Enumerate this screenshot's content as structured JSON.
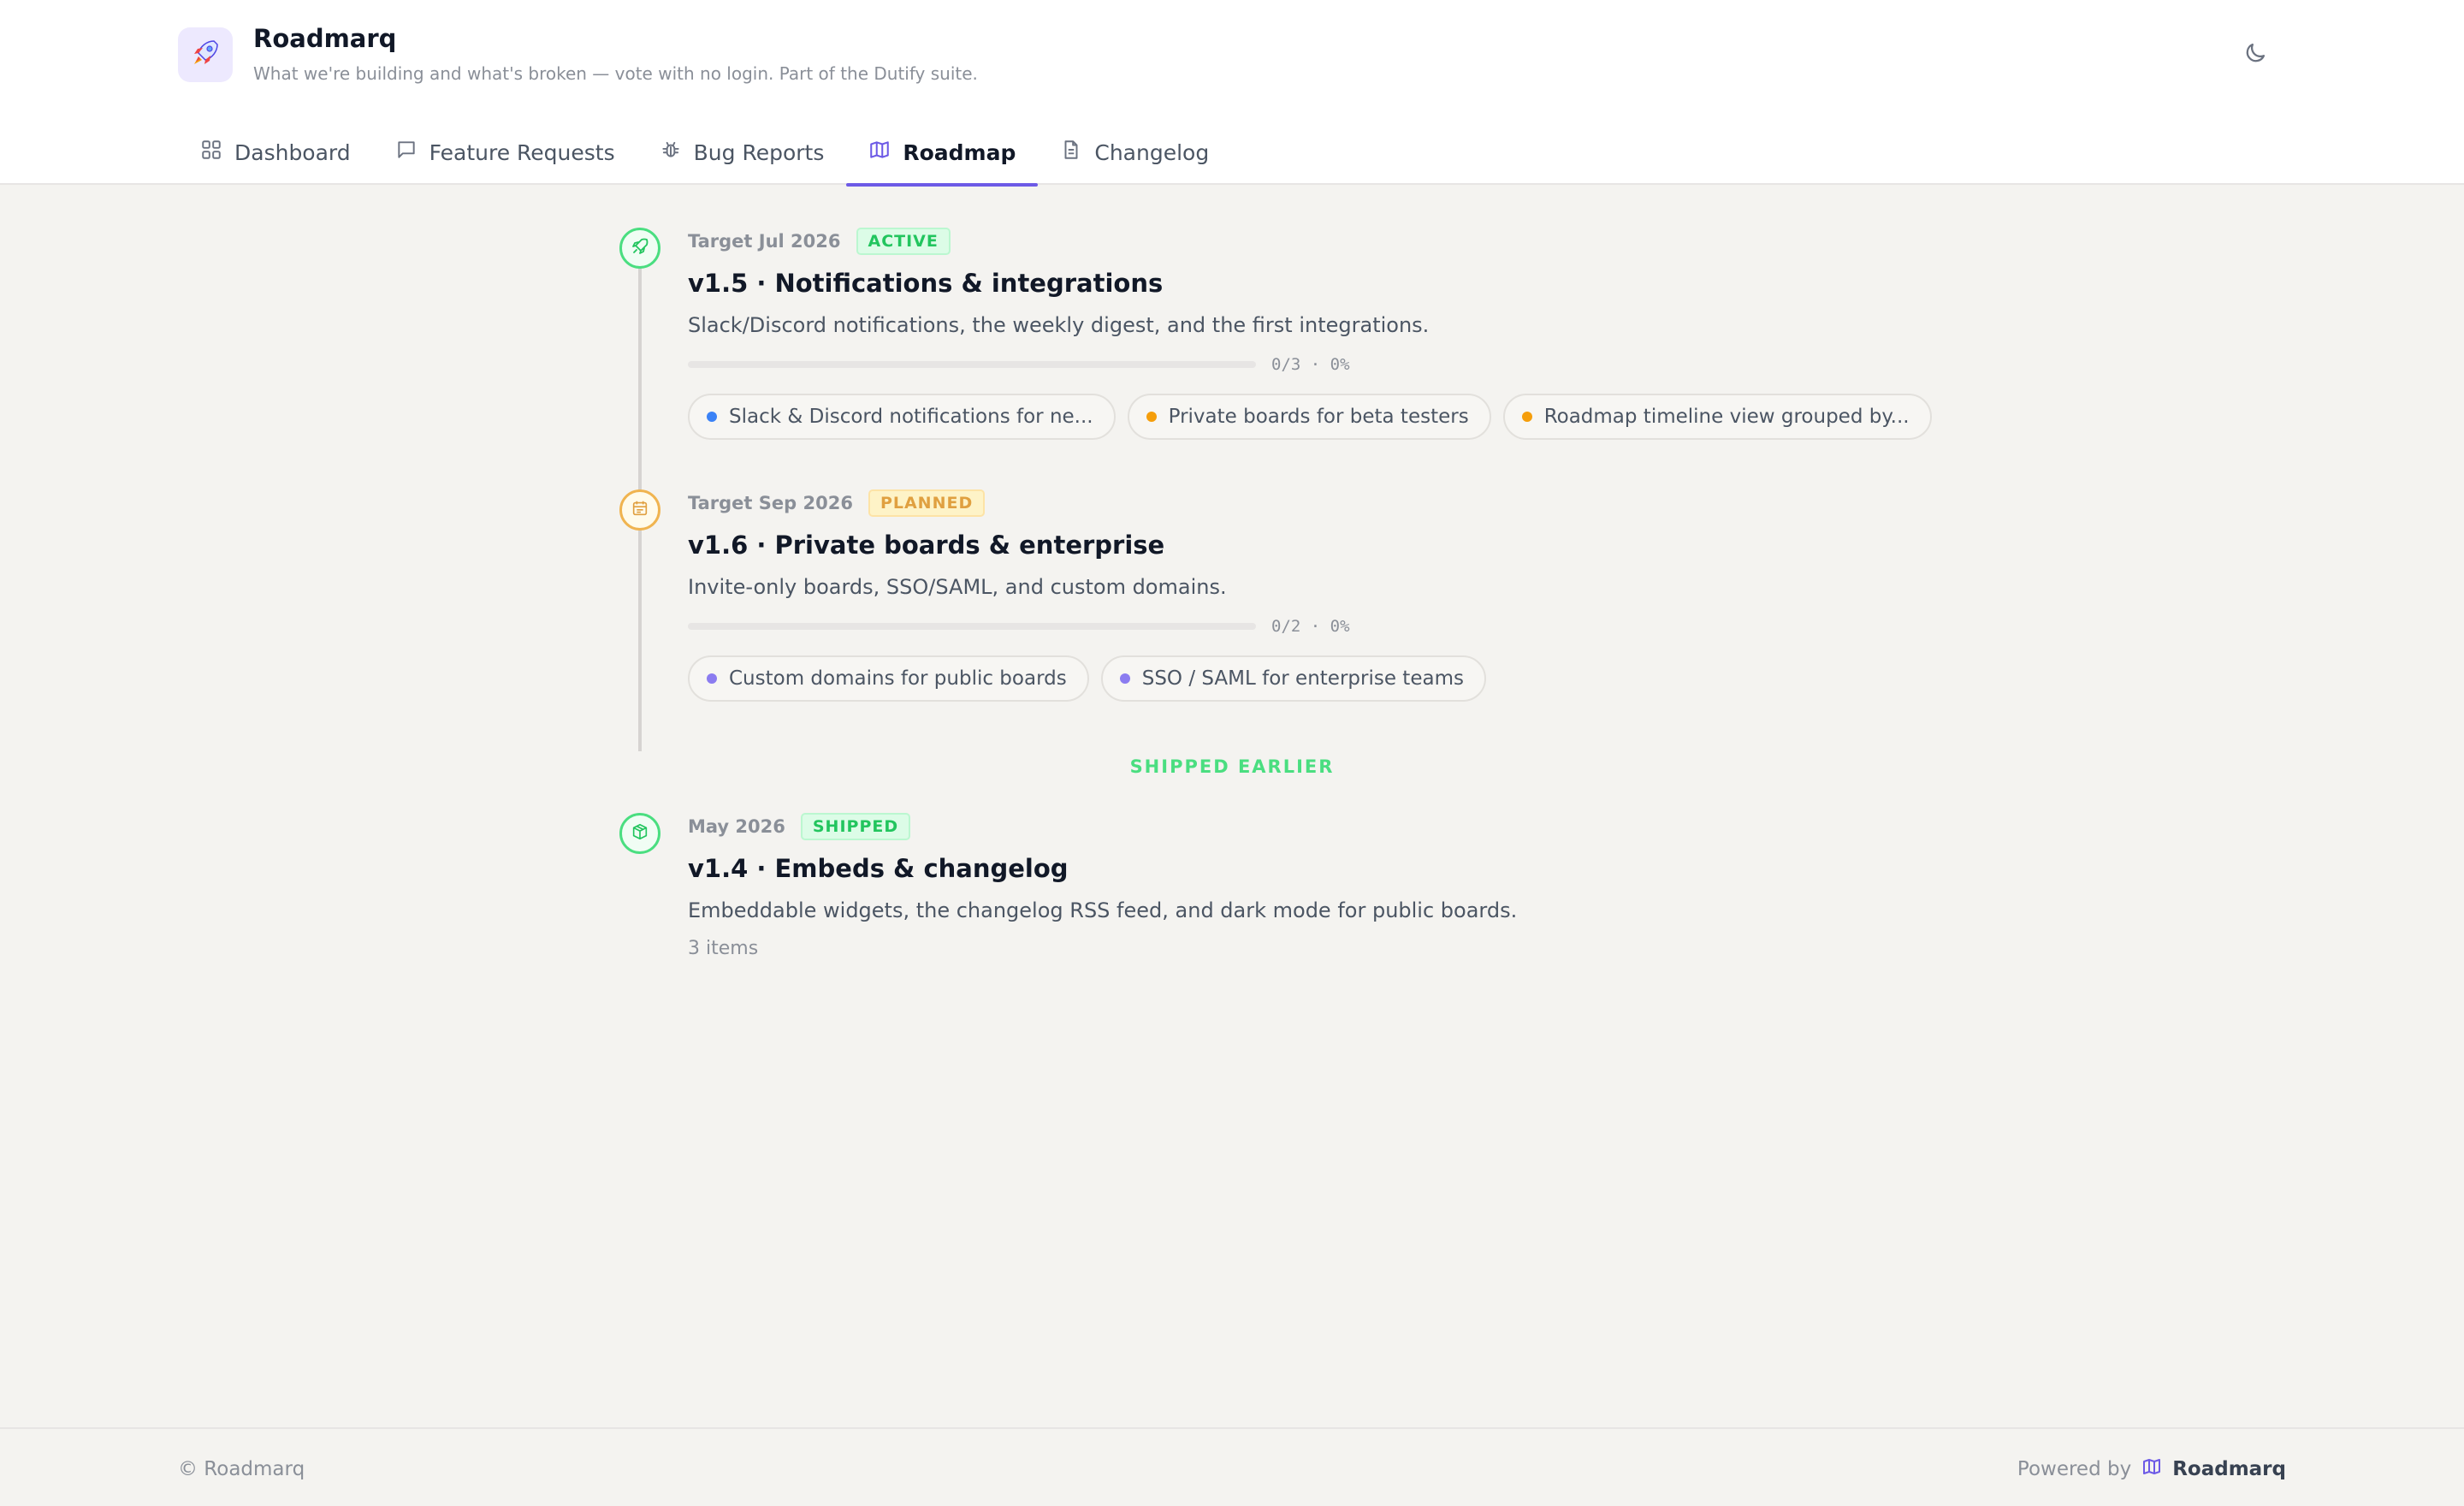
{
  "app": {
    "name": "Roadmarq",
    "tagline": "What we're building and what's broken — vote with no login. Part of the Dutify suite.",
    "logo_icon": "rocket-icon",
    "accent_color": "#6d5ae6"
  },
  "tabs": [
    {
      "label": "Dashboard",
      "icon": "grid-icon",
      "active": false
    },
    {
      "label": "Feature Requests",
      "icon": "message-icon",
      "active": false
    },
    {
      "label": "Bug Reports",
      "icon": "bug-icon",
      "active": false
    },
    {
      "label": "Roadmap",
      "icon": "map-icon",
      "active": true
    },
    {
      "label": "Changelog",
      "icon": "document-icon",
      "active": false
    }
  ],
  "theme_toggle_icon": "moon-icon",
  "releases": [
    {
      "target": "Target Jul 2026",
      "status": "ACTIVE",
      "status_color": "#22c55e",
      "icon": "rocket-icon",
      "title": "v1.5 · Notifications & integrations",
      "description": "Slack/Discord notifications, the weekly digest, and the first integrations.",
      "progress_text": "0/3 · 0%",
      "progress_fraction": 0,
      "items": [
        {
          "label": "Slack & Discord notifications for ne...",
          "color": "#3b82f6"
        },
        {
          "label": "Private boards for beta testers",
          "color": "#f59e0b"
        },
        {
          "label": "Roadmap timeline view grouped by...",
          "color": "#f59e0b"
        }
      ]
    },
    {
      "target": "Target Sep 2026",
      "status": "PLANNED",
      "status_color": "#e0a040",
      "icon": "calendar-icon",
      "title": "v1.6 · Private boards & enterprise",
      "description": "Invite-only boards, SSO/SAML, and custom domains.",
      "progress_text": "0/2 · 0%",
      "progress_fraction": 0,
      "items": [
        {
          "label": "Custom domains for public boards",
          "color": "#8b7cf0"
        },
        {
          "label": "SSO / SAML for enterprise teams",
          "color": "#8b7cf0"
        }
      ]
    }
  ],
  "shipped_section_label": "SHIPPED EARLIER",
  "shipped_releases": [
    {
      "target": "May 2026",
      "status": "SHIPPED",
      "icon": "package-icon",
      "title": "v1.4 · Embeds & changelog",
      "description": "Embeddable widgets, the changelog RSS feed, and dark mode for public boards.",
      "items_count": "3 items"
    }
  ],
  "footer": {
    "copyright": "© Roadmarq",
    "powered_by": "Powered by",
    "brand": "Roadmarq",
    "brand_icon": "map-icon"
  }
}
